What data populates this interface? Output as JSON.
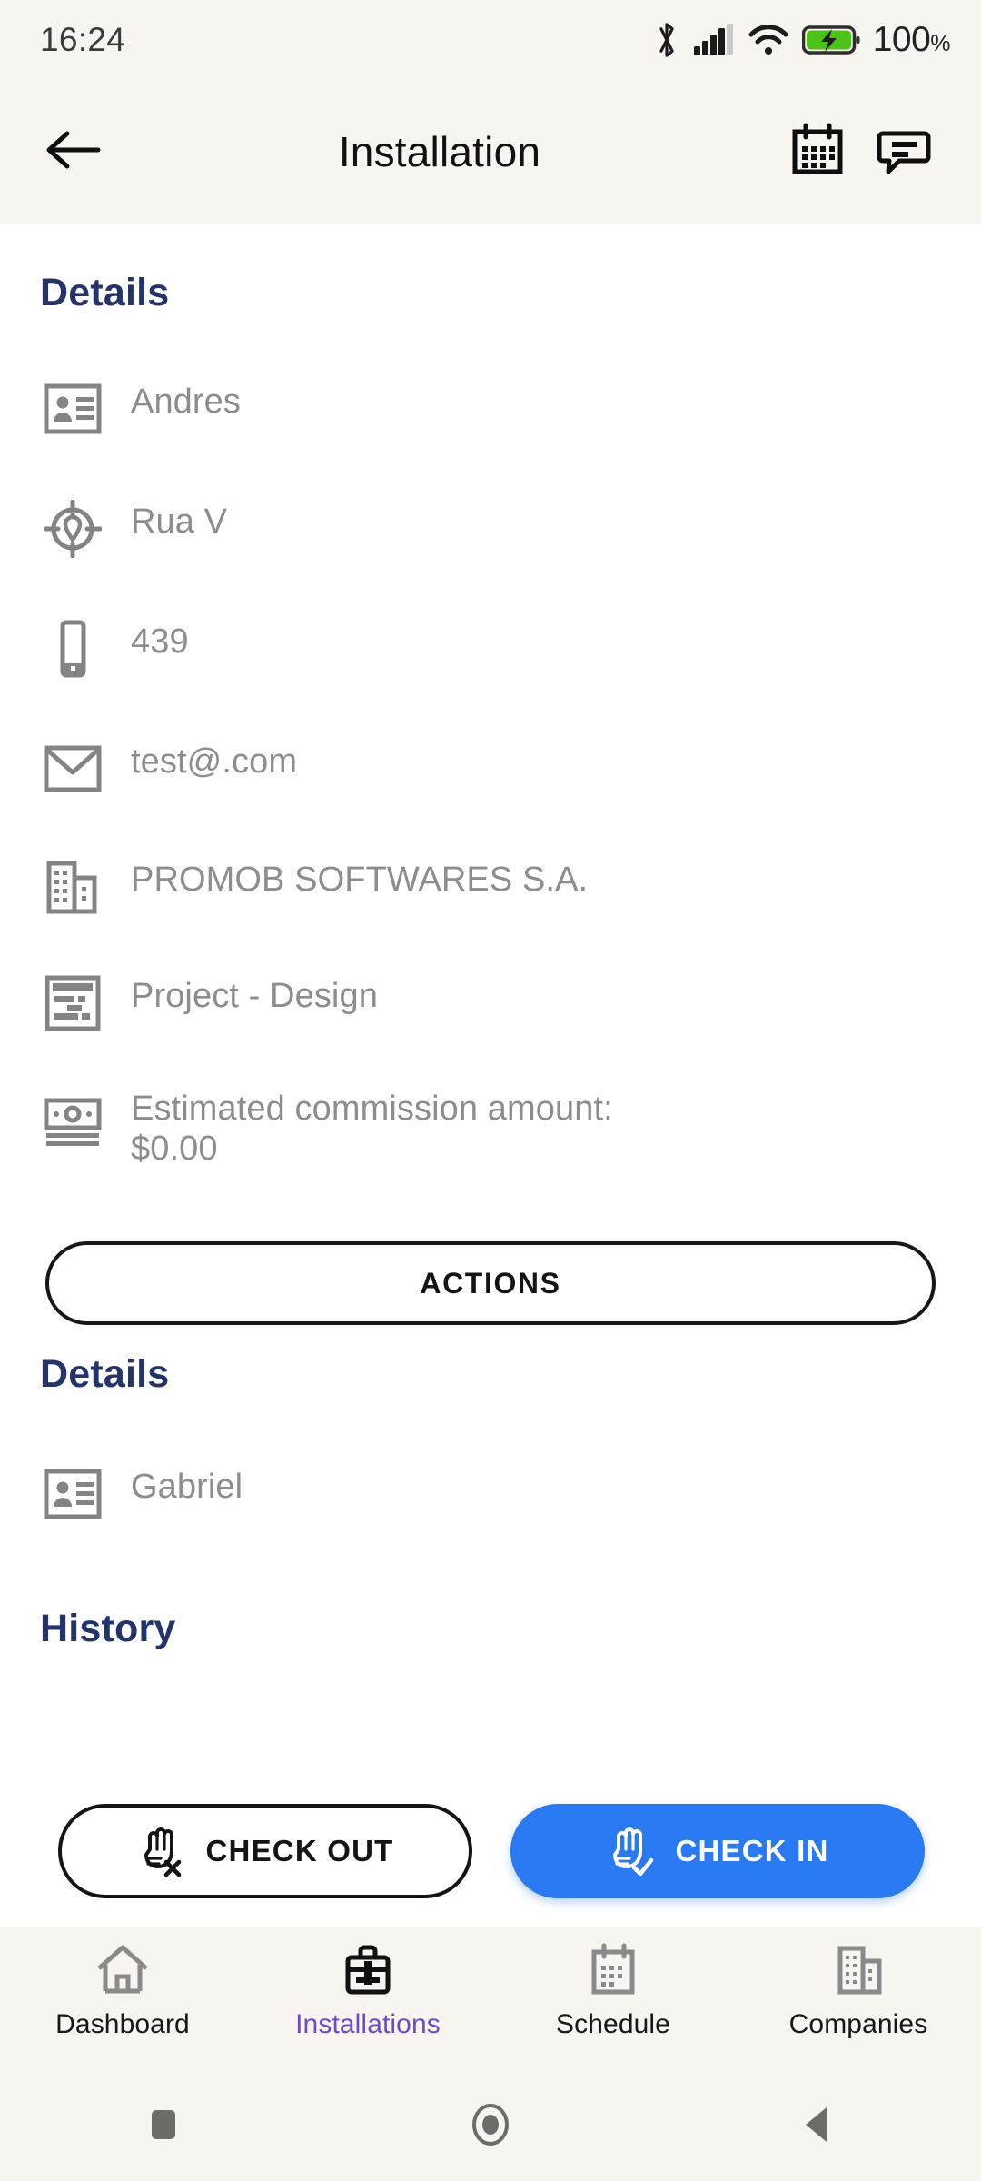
{
  "status_bar": {
    "clock": "16:24",
    "battery_percent": "100",
    "percent_symbol": "%",
    "icons": [
      "bluetooth-icon",
      "cellular-signal-icon",
      "wifi-icon",
      "battery-charging-icon"
    ]
  },
  "app_bar": {
    "back_icon": "back-arrow-icon",
    "title": "Installation",
    "calendar_icon": "calendar-icon",
    "message_icon": "message-icon"
  },
  "details_primary": {
    "heading": "Details",
    "rows": [
      {
        "icon": "contact-card-icon",
        "value": "Andres"
      },
      {
        "icon": "gps-location-icon",
        "value": "Rua V"
      },
      {
        "icon": "mobile-phone-icon",
        "value": "439"
      },
      {
        "icon": "envelope-icon",
        "value": "test@.com"
      },
      {
        "icon": "building-icon",
        "value": "PROMOB SOFTWARES S.A."
      },
      {
        "icon": "document-window-icon",
        "value": "Project - Design"
      },
      {
        "icon": "money-icon",
        "value": "Estimated commission amount:\n$0.00"
      }
    ]
  },
  "actions_button": {
    "label": "ACTIONS"
  },
  "details_secondary": {
    "heading": "Details",
    "rows": [
      {
        "icon": "contact-card-icon",
        "value": "Gabriel"
      }
    ]
  },
  "history": {
    "heading": "History"
  },
  "check_buttons": {
    "check_out": {
      "label": "CHECK OUT",
      "icon": "hand-x-icon"
    },
    "check_in": {
      "label": "CHECK IN",
      "icon": "hand-check-icon"
    }
  },
  "bottom_nav": {
    "items": [
      {
        "label": "Dashboard",
        "icon": "home-icon",
        "active": false
      },
      {
        "label": "Installations",
        "icon": "briefcase-icon",
        "active": true
      },
      {
        "label": "Schedule",
        "icon": "calendar-icon",
        "active": false
      },
      {
        "label": "Companies",
        "icon": "buildings-icon",
        "active": false
      }
    ]
  },
  "system_nav": {
    "recents_icon": "square-recents-icon",
    "home_icon": "circle-home-icon",
    "back_icon": "triangle-back-icon"
  },
  "colors": {
    "header_bg": "#f8f4f0",
    "content_bg": "#ffffff",
    "section_heading": "#23336b",
    "value_text": "#8d8d8d",
    "accent_blue": "#2979f2",
    "active_nav": "#6b49c8",
    "battery_green": "#4cc417"
  }
}
